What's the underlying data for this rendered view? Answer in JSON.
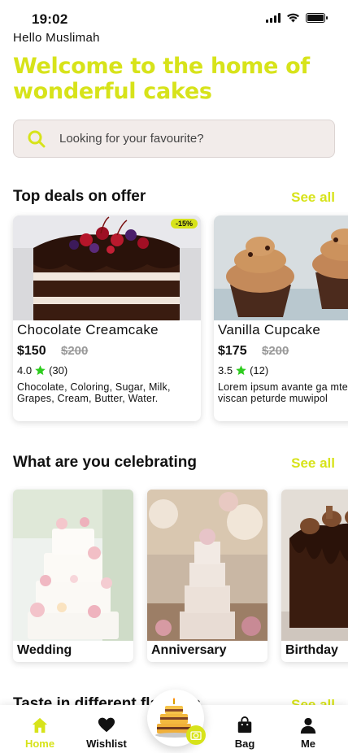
{
  "status_bar": {
    "time": "19:02"
  },
  "greeting": "Hello Muslimah",
  "headline": "Welcome to the home of wonderful cakes",
  "search": {
    "placeholder": "Looking for your favourite?"
  },
  "sections": {
    "deals": {
      "title": "Top deals on offer",
      "see_all": "See all"
    },
    "celebrating": {
      "title": "What are you celebrating",
      "see_all": "See all"
    },
    "taste": {
      "title": "Taste in different flavours",
      "see_all": "See all"
    }
  },
  "deals": [
    {
      "name": "Chocolate Creamcake",
      "price": "$150",
      "old_price": "$200",
      "rating": "4.0",
      "reviews": "(30)",
      "discount": "-15%",
      "description": "Chocolate, Coloring, Sugar, Milk, Grapes, Cream, Butter, Water."
    },
    {
      "name": "Vanilla Cupcake",
      "price": "$175",
      "old_price": "$200",
      "rating": "3.5",
      "reviews": "(12)",
      "description": "Lorem ipsum avante ga mtewrm viscan peturde muwipol"
    }
  ],
  "celebrations": [
    {
      "label": "Wedding"
    },
    {
      "label": "Anniversary"
    },
    {
      "label": "Birthday"
    }
  ],
  "nav": {
    "home": "Home",
    "wishlist": "Wishlist",
    "bag": "Bag",
    "me": "Me"
  },
  "colors": {
    "accent": "#d7e31a",
    "star": "#2ecc1f",
    "text": "#111111"
  },
  "icons": {
    "search": "search-icon",
    "home": "home-icon",
    "wishlist": "heart-icon",
    "center": "cake-camera-icon",
    "bag": "bag-icon",
    "me": "person-icon"
  }
}
